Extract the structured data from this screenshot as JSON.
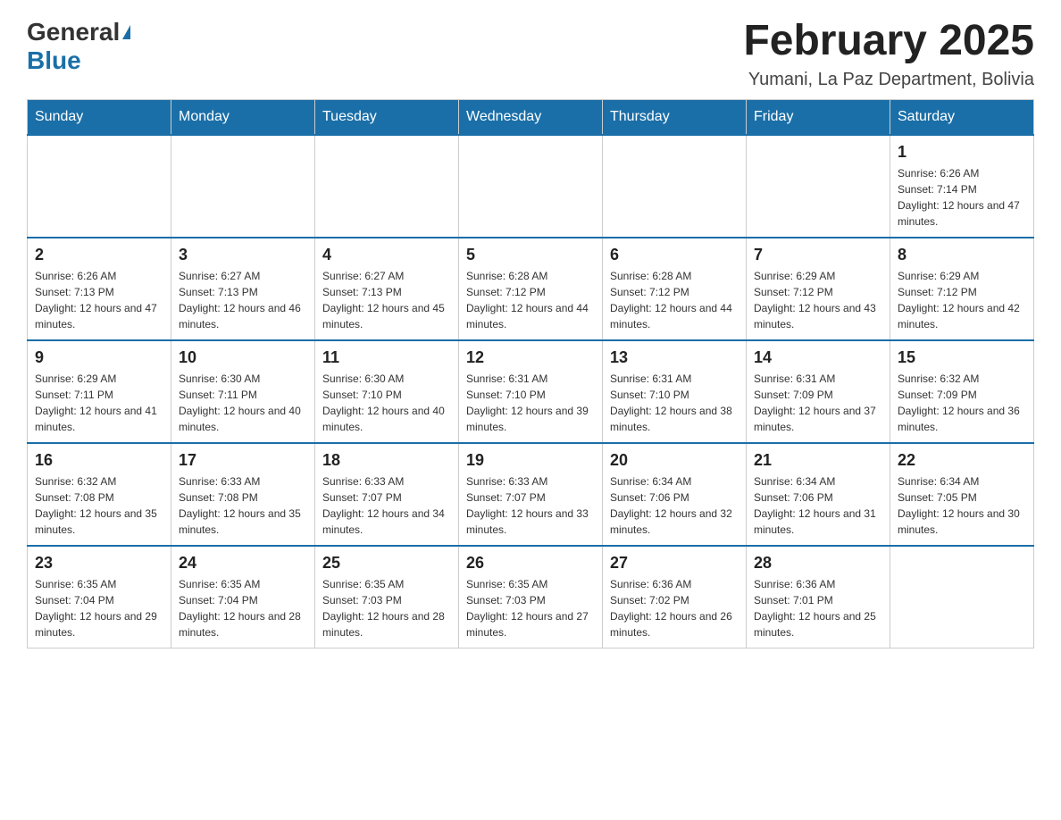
{
  "header": {
    "logo": {
      "general": "General",
      "blue": "Blue"
    },
    "title": "February 2025",
    "subtitle": "Yumani, La Paz Department, Bolivia"
  },
  "days_of_week": [
    "Sunday",
    "Monday",
    "Tuesday",
    "Wednesday",
    "Thursday",
    "Friday",
    "Saturday"
  ],
  "weeks": [
    [
      {
        "day": "",
        "info": ""
      },
      {
        "day": "",
        "info": ""
      },
      {
        "day": "",
        "info": ""
      },
      {
        "day": "",
        "info": ""
      },
      {
        "day": "",
        "info": ""
      },
      {
        "day": "",
        "info": ""
      },
      {
        "day": "1",
        "info": "Sunrise: 6:26 AM\nSunset: 7:14 PM\nDaylight: 12 hours and 47 minutes."
      }
    ],
    [
      {
        "day": "2",
        "info": "Sunrise: 6:26 AM\nSunset: 7:13 PM\nDaylight: 12 hours and 47 minutes."
      },
      {
        "day": "3",
        "info": "Sunrise: 6:27 AM\nSunset: 7:13 PM\nDaylight: 12 hours and 46 minutes."
      },
      {
        "day": "4",
        "info": "Sunrise: 6:27 AM\nSunset: 7:13 PM\nDaylight: 12 hours and 45 minutes."
      },
      {
        "day": "5",
        "info": "Sunrise: 6:28 AM\nSunset: 7:12 PM\nDaylight: 12 hours and 44 minutes."
      },
      {
        "day": "6",
        "info": "Sunrise: 6:28 AM\nSunset: 7:12 PM\nDaylight: 12 hours and 44 minutes."
      },
      {
        "day": "7",
        "info": "Sunrise: 6:29 AM\nSunset: 7:12 PM\nDaylight: 12 hours and 43 minutes."
      },
      {
        "day": "8",
        "info": "Sunrise: 6:29 AM\nSunset: 7:12 PM\nDaylight: 12 hours and 42 minutes."
      }
    ],
    [
      {
        "day": "9",
        "info": "Sunrise: 6:29 AM\nSunset: 7:11 PM\nDaylight: 12 hours and 41 minutes."
      },
      {
        "day": "10",
        "info": "Sunrise: 6:30 AM\nSunset: 7:11 PM\nDaylight: 12 hours and 40 minutes."
      },
      {
        "day": "11",
        "info": "Sunrise: 6:30 AM\nSunset: 7:10 PM\nDaylight: 12 hours and 40 minutes."
      },
      {
        "day": "12",
        "info": "Sunrise: 6:31 AM\nSunset: 7:10 PM\nDaylight: 12 hours and 39 minutes."
      },
      {
        "day": "13",
        "info": "Sunrise: 6:31 AM\nSunset: 7:10 PM\nDaylight: 12 hours and 38 minutes."
      },
      {
        "day": "14",
        "info": "Sunrise: 6:31 AM\nSunset: 7:09 PM\nDaylight: 12 hours and 37 minutes."
      },
      {
        "day": "15",
        "info": "Sunrise: 6:32 AM\nSunset: 7:09 PM\nDaylight: 12 hours and 36 minutes."
      }
    ],
    [
      {
        "day": "16",
        "info": "Sunrise: 6:32 AM\nSunset: 7:08 PM\nDaylight: 12 hours and 35 minutes."
      },
      {
        "day": "17",
        "info": "Sunrise: 6:33 AM\nSunset: 7:08 PM\nDaylight: 12 hours and 35 minutes."
      },
      {
        "day": "18",
        "info": "Sunrise: 6:33 AM\nSunset: 7:07 PM\nDaylight: 12 hours and 34 minutes."
      },
      {
        "day": "19",
        "info": "Sunrise: 6:33 AM\nSunset: 7:07 PM\nDaylight: 12 hours and 33 minutes."
      },
      {
        "day": "20",
        "info": "Sunrise: 6:34 AM\nSunset: 7:06 PM\nDaylight: 12 hours and 32 minutes."
      },
      {
        "day": "21",
        "info": "Sunrise: 6:34 AM\nSunset: 7:06 PM\nDaylight: 12 hours and 31 minutes."
      },
      {
        "day": "22",
        "info": "Sunrise: 6:34 AM\nSunset: 7:05 PM\nDaylight: 12 hours and 30 minutes."
      }
    ],
    [
      {
        "day": "23",
        "info": "Sunrise: 6:35 AM\nSunset: 7:04 PM\nDaylight: 12 hours and 29 minutes."
      },
      {
        "day": "24",
        "info": "Sunrise: 6:35 AM\nSunset: 7:04 PM\nDaylight: 12 hours and 28 minutes."
      },
      {
        "day": "25",
        "info": "Sunrise: 6:35 AM\nSunset: 7:03 PM\nDaylight: 12 hours and 28 minutes."
      },
      {
        "day": "26",
        "info": "Sunrise: 6:35 AM\nSunset: 7:03 PM\nDaylight: 12 hours and 27 minutes."
      },
      {
        "day": "27",
        "info": "Sunrise: 6:36 AM\nSunset: 7:02 PM\nDaylight: 12 hours and 26 minutes."
      },
      {
        "day": "28",
        "info": "Sunrise: 6:36 AM\nSunset: 7:01 PM\nDaylight: 12 hours and 25 minutes."
      },
      {
        "day": "",
        "info": ""
      }
    ]
  ]
}
